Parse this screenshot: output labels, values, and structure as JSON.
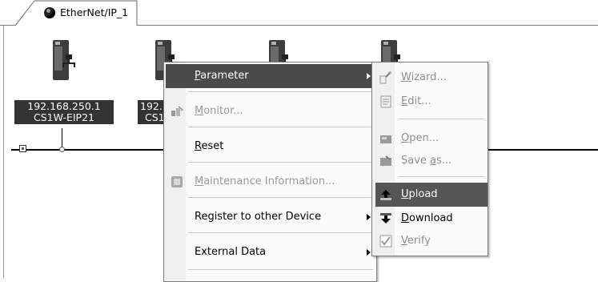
{
  "tab": {
    "label": "EtherNet/IP_1"
  },
  "nodes": [
    {
      "ip": "192.168.250.1",
      "model": "CS1W-EIP21"
    },
    {
      "ip": "192.",
      "model": "CS1"
    }
  ],
  "context_menu": {
    "items": [
      {
        "label_pre": "",
        "label_u": "P",
        "label_post": "arameter",
        "state": "highlighted",
        "submenu": true
      },
      {
        "label_pre": "",
        "label_u": "M",
        "label_post": "onitor...",
        "state": "disabled",
        "icon": "monitor-icon"
      },
      {
        "label_pre": "",
        "label_u": "R",
        "label_post": "eset",
        "state": "enabled"
      },
      {
        "label_pre": "",
        "label_u": "M",
        "label_post": "aintenance Information...",
        "state": "disabled",
        "icon": "maintenance-icon"
      },
      {
        "label": "Register to other Device",
        "state": "enabled",
        "submenu": true
      },
      {
        "label": "External Data",
        "state": "enabled",
        "submenu": true
      }
    ]
  },
  "parameter_submenu": {
    "items": [
      {
        "label_u": "W",
        "label_post": "izard...",
        "state": "disabled",
        "icon": "wizard-icon"
      },
      {
        "label_u": "E",
        "label_post": "dit...",
        "state": "disabled",
        "icon": "edit-icon"
      },
      {
        "label_u": "O",
        "label_post": "pen...",
        "state": "disabled",
        "icon": "open-icon"
      },
      {
        "label_pre": "Save ",
        "label_u": "a",
        "label_post": "s...",
        "state": "disabled",
        "icon": "save-as-icon"
      },
      {
        "label_u": "U",
        "label_post": "pload",
        "state": "highlighted",
        "icon": "upload-icon"
      },
      {
        "label_u": "D",
        "label_post": "ownload",
        "state": "enabled",
        "icon": "download-icon"
      },
      {
        "label_u": "V",
        "label_post": "erify",
        "state": "disabled",
        "icon": "verify-icon"
      }
    ]
  }
}
